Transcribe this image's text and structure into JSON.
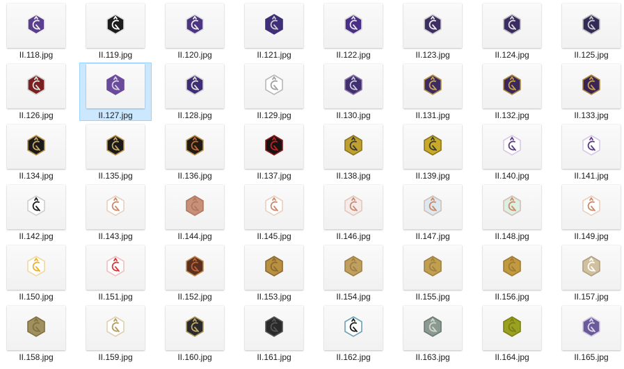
{
  "files": [
    {
      "name": "II.118.jpg",
      "fill": "#5a3f8c",
      "stroke": "#eeeeee",
      "glyph": "#eeeeee"
    },
    {
      "name": "II.119.jpg",
      "fill": "#1c1c1c",
      "stroke": "#dddddd",
      "glyph": "#ffffff"
    },
    {
      "name": "II.120.jpg",
      "fill": "#4b3480",
      "stroke": "#dddddd",
      "glyph": "#eeeeee"
    },
    {
      "name": "II.121.jpg",
      "fill": "#3e2f78",
      "stroke": "#3e2f78",
      "glyph": "#cccccc"
    },
    {
      "name": "II.122.jpg",
      "fill": "#4a2f88",
      "stroke": "#d8d8d8",
      "glyph": "#e6e6e6"
    },
    {
      "name": "II.123.jpg",
      "fill": "#3d2f62",
      "stroke": "#cfcfcf",
      "glyph": "#eeeeee"
    },
    {
      "name": "II.124.jpg",
      "fill": "#3a2c60",
      "stroke": "#bdbdbd",
      "glyph": "#dddddd"
    },
    {
      "name": "II.125.jpg",
      "fill": "#332a55",
      "stroke": "#bdbdbd",
      "glyph": "#cccccc"
    },
    {
      "name": "II.126.jpg",
      "fill": "#7a2020",
      "stroke": "#cfcfcf",
      "glyph": "#e0e0e0"
    },
    {
      "name": "II.127.jpg",
      "fill": "#6a4a9a",
      "stroke": "#6a4a9a",
      "glyph": "#d8d0e8"
    },
    {
      "name": "II.128.jpg",
      "fill": "#3e2d75",
      "stroke": "#cfcfcf",
      "glyph": "#e0e0e0"
    },
    {
      "name": "II.129.jpg",
      "fill": "#ffffff",
      "stroke": "#b8b8b8",
      "glyph": "#a0a0a0"
    },
    {
      "name": "II.130.jpg",
      "fill": "#403070",
      "stroke": "#8d7aa8",
      "glyph": "#d0c8e0"
    },
    {
      "name": "II.131.jpg",
      "fill": "#3c2a60",
      "stroke": "#b8944a",
      "glyph": "#c8a860"
    },
    {
      "name": "II.132.jpg",
      "fill": "#3a2858",
      "stroke": "#b08a40",
      "glyph": "#c8a050"
    },
    {
      "name": "II.133.jpg",
      "fill": "#3a2455",
      "stroke": "#b08a40",
      "glyph": "#c8a050"
    },
    {
      "name": "II.134.jpg",
      "fill": "#1a1a1a",
      "stroke": "#b8944a",
      "glyph": "#c8a860"
    },
    {
      "name": "II.135.jpg",
      "fill": "#1a1a1a",
      "stroke": "#b8944a",
      "glyph": "#c8a860"
    },
    {
      "name": "II.136.jpg",
      "fill": "#221a14",
      "stroke": "#b8944a",
      "glyph": "#c06a30"
    },
    {
      "name": "II.137.jpg",
      "fill": "#1a1212",
      "stroke": "#8a1a1a",
      "glyph": "#c02020"
    },
    {
      "name": "II.138.jpg",
      "fill": "#c0a030",
      "stroke": "#8a7520",
      "glyph": "#3a3a3a"
    },
    {
      "name": "II.139.jpg",
      "fill": "#c8aa28",
      "stroke": "#8a7520",
      "glyph": "#3a3a3a"
    },
    {
      "name": "II.140.jpg",
      "fill": "#ffffff",
      "stroke": "#d8c8e8",
      "glyph": "#5a3a8a"
    },
    {
      "name": "II.141.jpg",
      "fill": "#ffffff",
      "stroke": "#d8c8e8",
      "glyph": "#5a3a8a"
    },
    {
      "name": "II.142.jpg",
      "fill": "#ffffff",
      "stroke": "#cfcfcf",
      "glyph": "#1a1a1a"
    },
    {
      "name": "II.143.jpg",
      "fill": "#ffffff",
      "stroke": "#e8d0c0",
      "glyph": "#c88a6a"
    },
    {
      "name": "II.144.jpg",
      "fill": "#c89078",
      "stroke": "#b07860",
      "glyph": "#b07860"
    },
    {
      "name": "II.145.jpg",
      "fill": "#ffffff",
      "stroke": "#e8d0c0",
      "glyph": "#c88a6a"
    },
    {
      "name": "II.146.jpg",
      "fill": "#f5ece8",
      "stroke": "#e0c8c0",
      "glyph": "#c88a7a"
    },
    {
      "name": "II.147.jpg",
      "fill": "#dde8f0",
      "stroke": "#d0c0b8",
      "glyph": "#c88a6a"
    },
    {
      "name": "II.148.jpg",
      "fill": "#dcefe0",
      "stroke": "#d0c0b8",
      "glyph": "#c88a6a"
    },
    {
      "name": "II.149.jpg",
      "fill": "#ffffff",
      "stroke": "#e8d0c0",
      "glyph": "#c88a6a"
    },
    {
      "name": "II.150.jpg",
      "fill": "#ffffff",
      "stroke": "#f0d8a0",
      "glyph": "#f0b020"
    },
    {
      "name": "II.151.jpg",
      "fill": "#ffffff",
      "stroke": "#f0c0c0",
      "glyph": "#e03030"
    },
    {
      "name": "II.152.jpg",
      "fill": "#5a3020",
      "stroke": "#c08a50",
      "glyph": "#c06030"
    },
    {
      "name": "II.153.jpg",
      "fill": "#b89040",
      "stroke": "#8a6a30",
      "glyph": "#8a6a30"
    },
    {
      "name": "II.154.jpg",
      "fill": "#c0a060",
      "stroke": "#a08040",
      "glyph": "#a08040"
    },
    {
      "name": "II.155.jpg",
      "fill": "#c0a050",
      "stroke": "#a08040",
      "glyph": "#a08040"
    },
    {
      "name": "II.156.jpg",
      "fill": "#c09a40",
      "stroke": "#a07a30",
      "glyph": "#a07a30"
    },
    {
      "name": "II.157.jpg",
      "fill": "#d0c0a0",
      "stroke": "#b0a080",
      "glyph": "#ffffff"
    },
    {
      "name": "II.158.jpg",
      "fill": "#a09060",
      "stroke": "#807040",
      "glyph": "#807040"
    },
    {
      "name": "II.159.jpg",
      "fill": "#ffffff",
      "stroke": "#e0d0b0",
      "glyph": "#b09a60"
    },
    {
      "name": "II.160.jpg",
      "fill": "#2a2a2a",
      "stroke": "#b09a60",
      "glyph": "#c0a870"
    },
    {
      "name": "II.161.jpg",
      "fill": "#2a2a2a",
      "stroke": "#555555",
      "glyph": "#555555"
    },
    {
      "name": "II.162.jpg",
      "fill": "#ffffff",
      "stroke": "#6aa0b8",
      "glyph": "#1a1a1a"
    },
    {
      "name": "II.163.jpg",
      "fill": "#8a9a90",
      "stroke": "#6a7a70",
      "glyph": "#d0d8d0"
    },
    {
      "name": "II.164.jpg",
      "fill": "#9aa020",
      "stroke": "#7a8010",
      "glyph": "#7a8010"
    },
    {
      "name": "II.165.jpg",
      "fill": "#6a5a9a",
      "stroke": "#d0c8e0",
      "glyph": "#e0d8f0"
    }
  ],
  "selected": "II.127.jpg"
}
